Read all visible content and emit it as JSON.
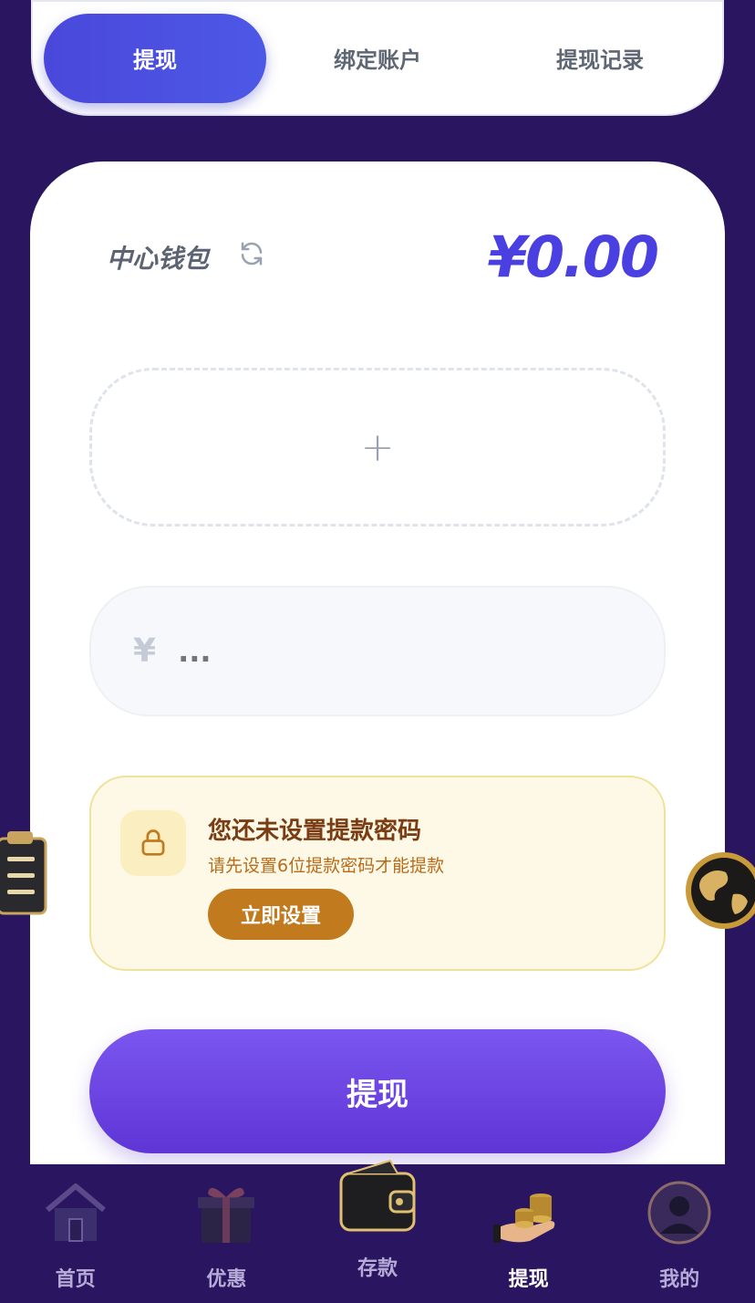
{
  "tabs": [
    {
      "label": "提现",
      "active": true
    },
    {
      "label": "绑定账户",
      "active": false
    },
    {
      "label": "提现记录",
      "active": false
    }
  ],
  "wallet": {
    "label": "中心钱包",
    "balance": "¥0.00"
  },
  "add_account": {
    "icon": "plus-icon",
    "symbol": "+"
  },
  "amount": {
    "currency_symbol": "¥",
    "placeholder": "..."
  },
  "notice": {
    "title": "您还未设置提款密码",
    "subtitle": "请先设置6位提款密码才能提款",
    "button": "立即设置"
  },
  "withdraw_button": "提现",
  "bottom_nav": [
    {
      "label": "首页",
      "icon": "house-icon",
      "active": false
    },
    {
      "label": "优惠",
      "icon": "gift-icon",
      "active": false
    },
    {
      "label": "存款",
      "icon": "wallet-icon",
      "active": false
    },
    {
      "label": "提现",
      "icon": "coins-hand-icon",
      "active": true
    },
    {
      "label": "我的",
      "icon": "user-avatar-icon",
      "active": false
    }
  ],
  "colors": {
    "background": "#2a1660",
    "accent": "#4a48db",
    "balance": "#4a3fe0",
    "withdraw_button": "#6b44e2",
    "notice_bg": "#fdf9e6",
    "notice_button": "#c27a1f"
  }
}
